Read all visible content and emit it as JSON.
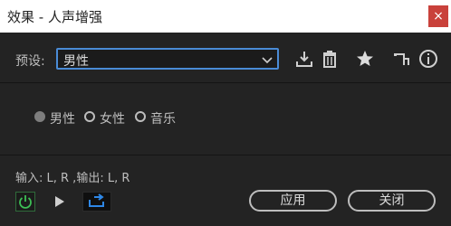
{
  "window": {
    "title": "效果 - 人声增强",
    "close_glyph": "×"
  },
  "preset": {
    "label": "预设:",
    "value": "男性"
  },
  "toolbar_icons": [
    "download-icon",
    "trash-icon",
    "star-icon",
    "routing-icon",
    "info-icon"
  ],
  "modes": [
    {
      "label": "男性",
      "selected": true
    },
    {
      "label": "女性",
      "selected": false
    },
    {
      "label": "音乐",
      "selected": false
    }
  ],
  "io": {
    "text": "输入: L, R ,输出: L, R"
  },
  "buttons": {
    "apply": "应用",
    "close": "关闭"
  },
  "colors": {
    "accent": "#4a8bd6",
    "power": "#3dbf55",
    "loop": "#2e87e6",
    "close_red": "#c9413b"
  }
}
